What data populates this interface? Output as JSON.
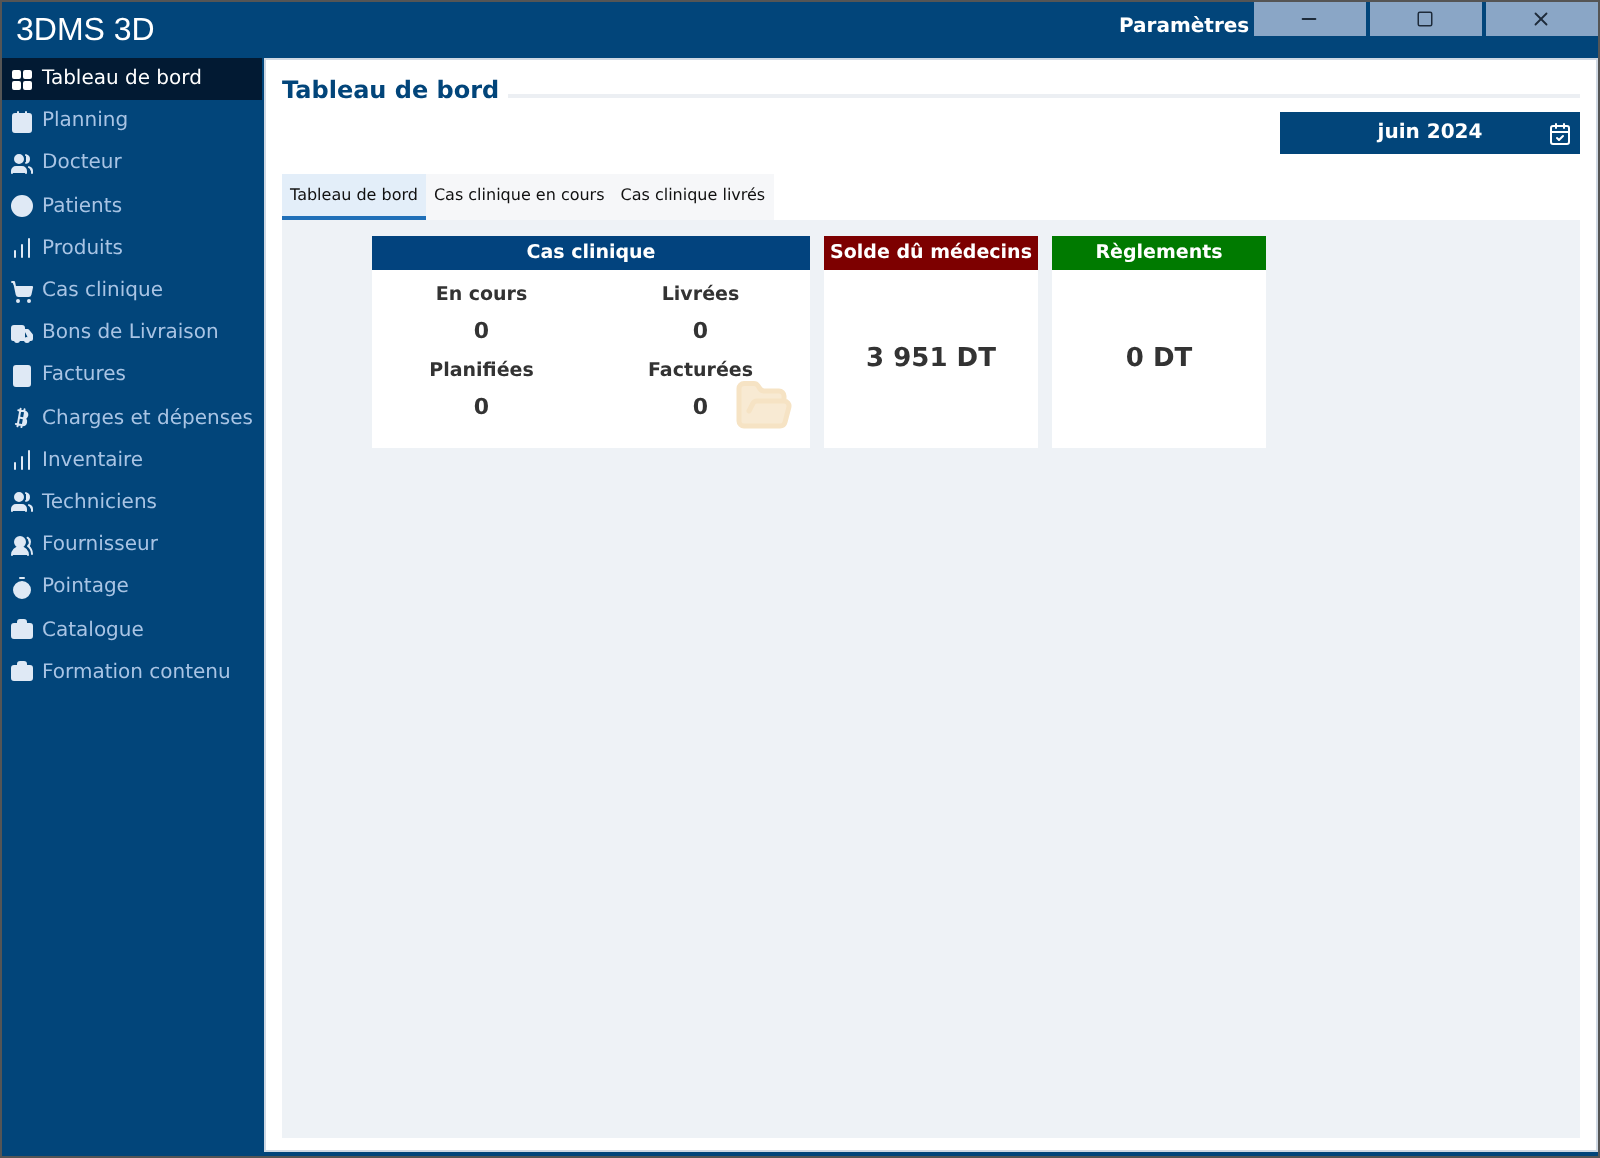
{
  "window": {
    "app_name": "3DMS 3D",
    "title": "Paramètres"
  },
  "sidebar": {
    "items": [
      {
        "label": "Tableau de bord",
        "selected": true
      },
      {
        "label": "Planning",
        "selected": false
      },
      {
        "label": "Docteur",
        "selected": false
      },
      {
        "label": "Patients",
        "selected": false
      },
      {
        "label": "Produits",
        "selected": false
      },
      {
        "label": "Cas clinique",
        "selected": false
      },
      {
        "label": "Bons de Livraison",
        "selected": false
      },
      {
        "label": "Factures",
        "selected": false
      },
      {
        "label": "Charges et dépenses",
        "selected": false
      },
      {
        "label": "Inventaire",
        "selected": false
      },
      {
        "label": "Techniciens",
        "selected": false
      },
      {
        "label": "Fournisseur",
        "selected": false
      },
      {
        "label": "Pointage",
        "selected": false
      },
      {
        "label": "Catalogue",
        "selected": false
      },
      {
        "label": "Formation contenu",
        "selected": false
      }
    ]
  },
  "panel": {
    "title": "Tableau de bord",
    "month": "juin 2024"
  },
  "tabs": [
    {
      "label": "Tableau de bord",
      "selected": true
    },
    {
      "label": "Cas clinique en cours",
      "selected": false
    },
    {
      "label": "Cas clinique livrés",
      "selected": false
    }
  ],
  "cards": [
    {
      "kind": "grid",
      "title": "Cas clinique",
      "color": "#02437e",
      "stats": [
        {
          "label": "En cours",
          "value": "0"
        },
        {
          "label": "Livrées",
          "value": "0"
        },
        {
          "label": "Planifiées",
          "value": "0"
        },
        {
          "label": "Facturées",
          "value": "0"
        }
      ]
    },
    {
      "kind": "total",
      "title": "Solde dû médecins",
      "color": "#7d0000",
      "value": "3 951 DT"
    },
    {
      "kind": "total",
      "title": "Règlements",
      "color": "#007a00",
      "value": "0 DT"
    }
  ]
}
